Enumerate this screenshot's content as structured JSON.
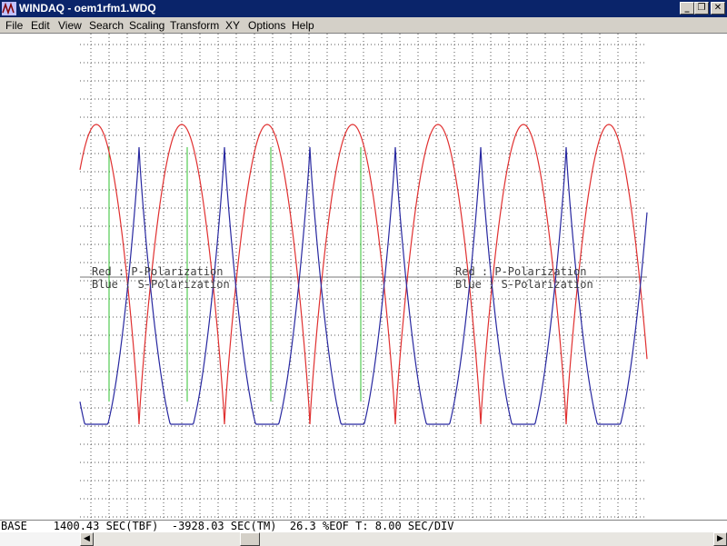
{
  "window": {
    "title": "WINDAQ - oem1rfm1.WDQ",
    "icon": "windaq-icon",
    "controls": {
      "minimize": "_",
      "restore": "❐",
      "close": "✕"
    }
  },
  "menu": {
    "items": [
      {
        "label": "File"
      },
      {
        "label": "Edit"
      },
      {
        "label": "View"
      },
      {
        "label": "Search"
      },
      {
        "label": "Scaling"
      },
      {
        "label": "Transform"
      },
      {
        "label": "XY"
      },
      {
        "label": "Options"
      },
      {
        "label": "Help"
      }
    ]
  },
  "plot": {
    "colors": {
      "p_polarization": "#e03030",
      "s_polarization": "#2828a0",
      "markers": "#30c030",
      "grid": "#555555"
    },
    "annotations": {
      "left": {
        "red": "Red : P-Polarization",
        "blue": "Blue : S-Polarization"
      },
      "right": {
        "red": "Red : P-Polarization",
        "blue": "Blue : S-Polarization"
      }
    }
  },
  "status": {
    "text": "BASE    1400.43 SEC(TBF)  -3928.03 SEC(TM)  26.3 %EOF T: 8.00 SEC/DIV"
  },
  "scrollbar": {
    "left_arrow": "◀",
    "right_arrow": "▶"
  }
}
